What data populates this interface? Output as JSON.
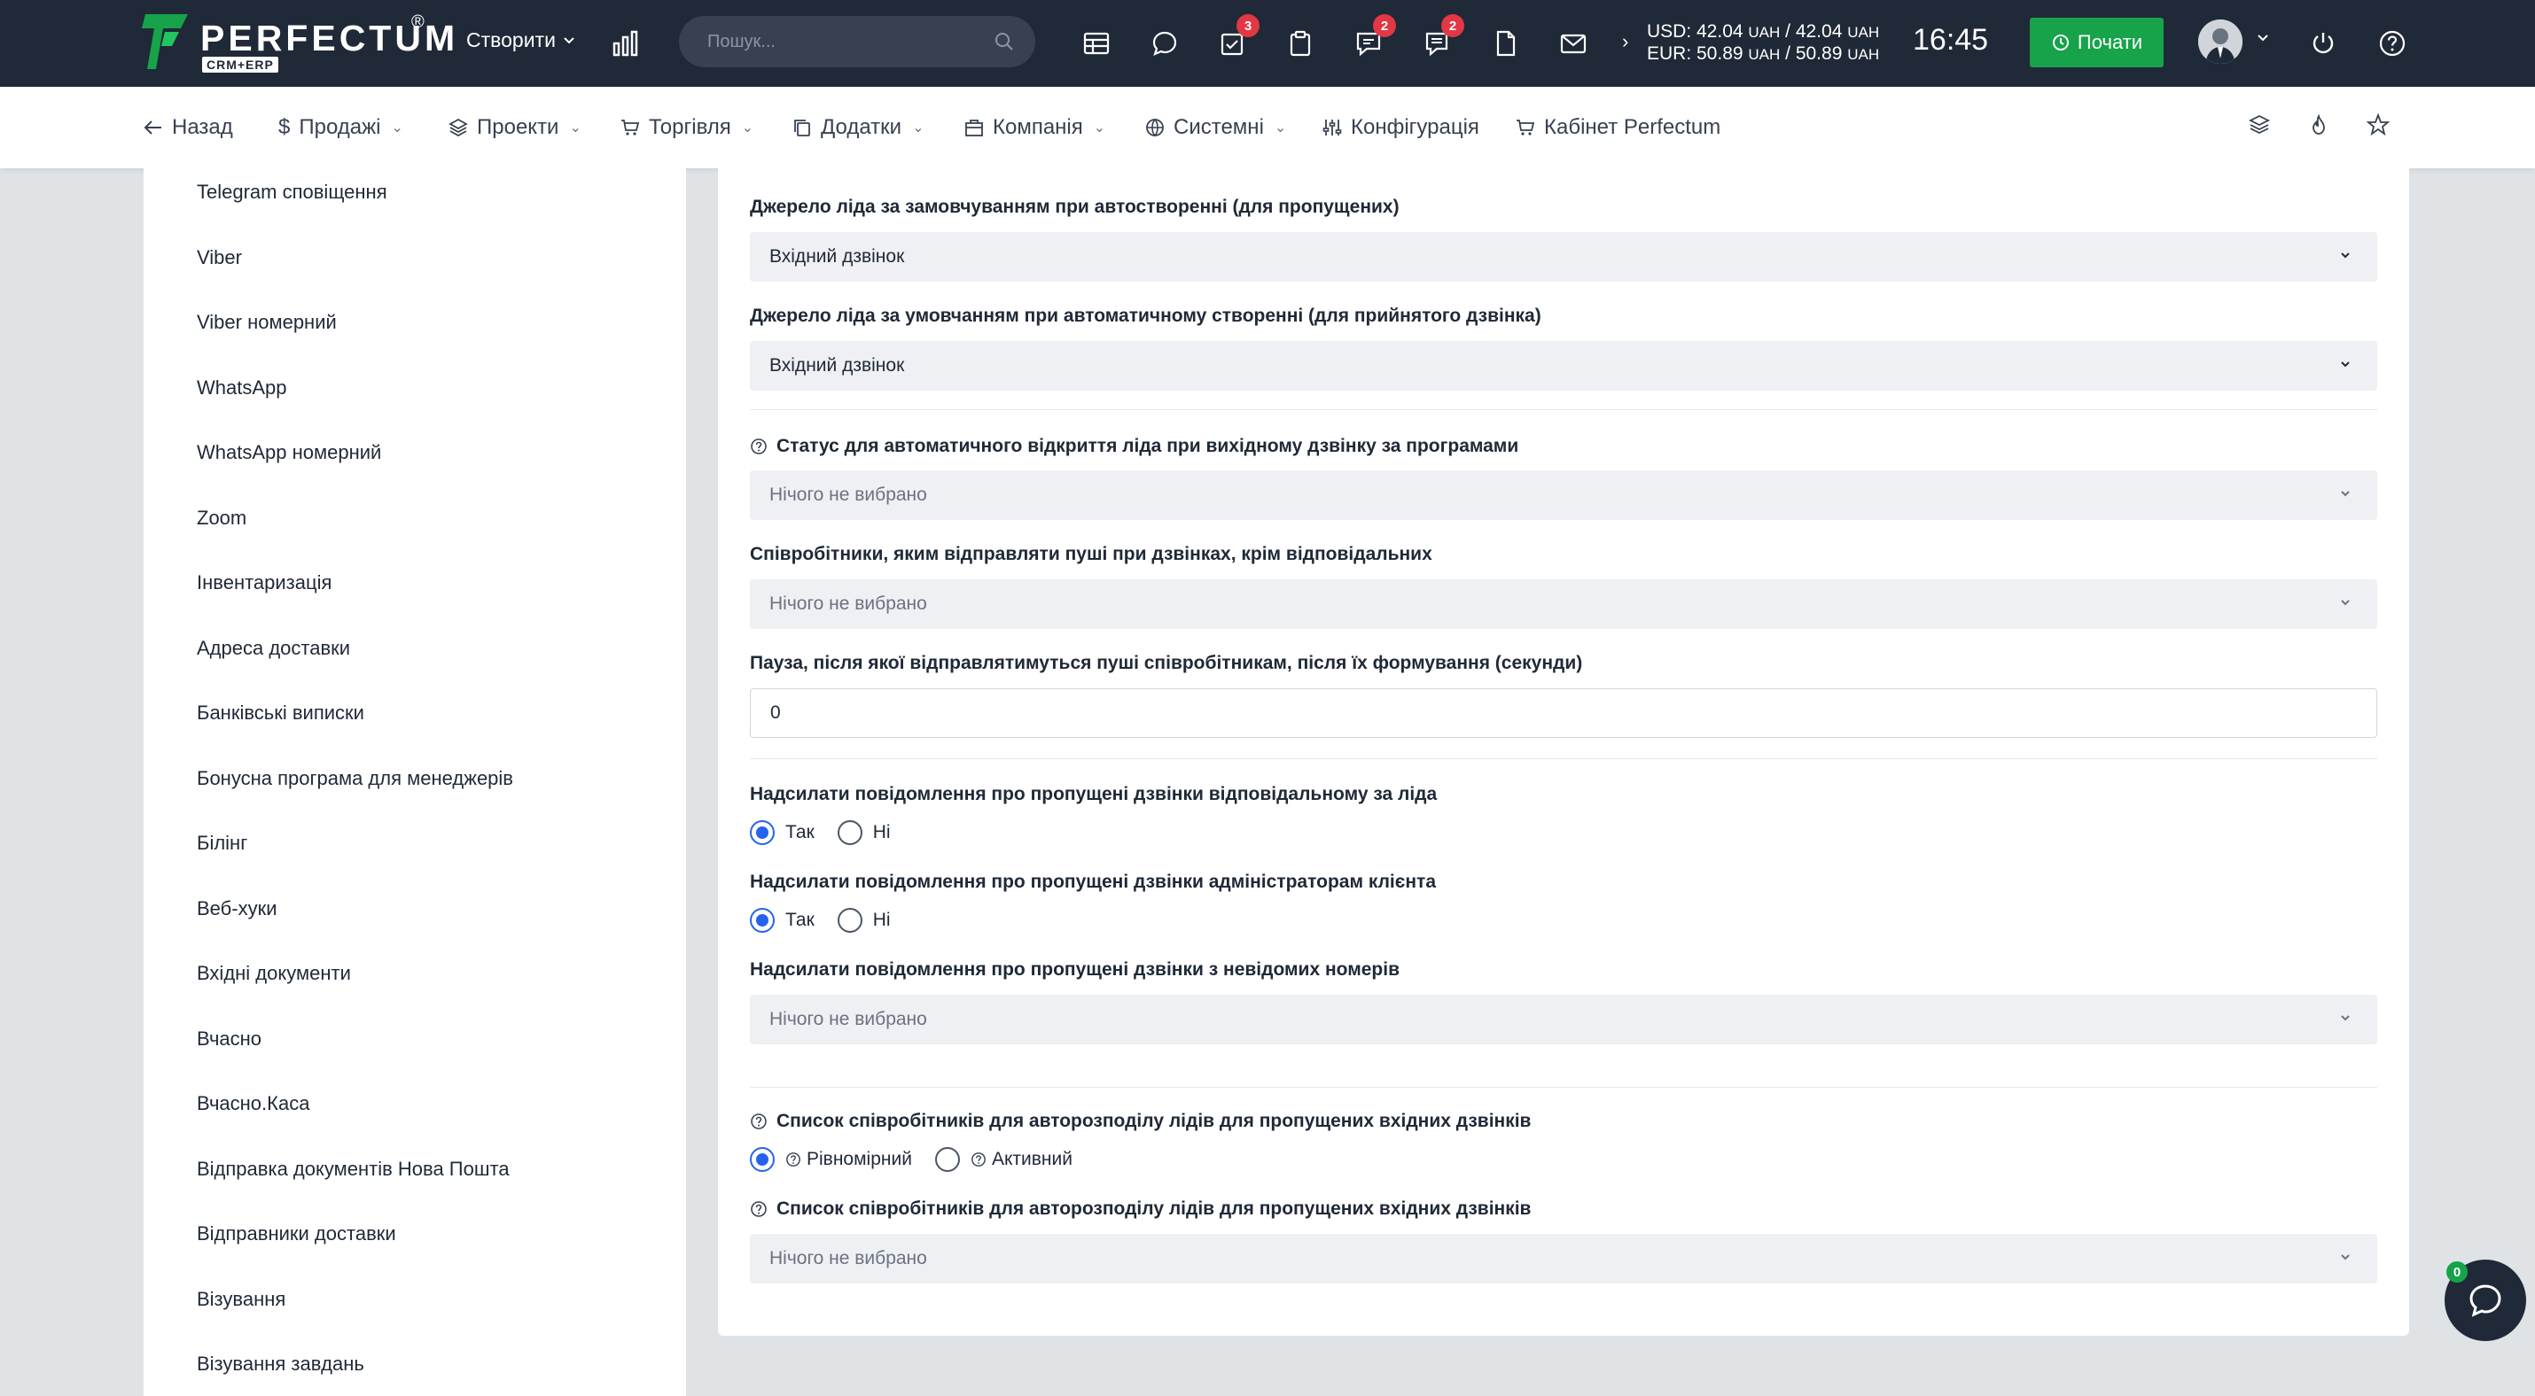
{
  "app": {
    "logo_text": "PERFECTUM",
    "logo_sub": "CRM+ERP",
    "logo_reg": "®",
    "brand_color": "#16a34a"
  },
  "topbar": {
    "create_label": "Створити",
    "search_placeholder": "Пошук...",
    "badges": {
      "tasks": "3",
      "chat": "2",
      "comments": "2"
    },
    "rates_line1": "USD: 42.04",
    "rates_unit1": "UAH",
    "rates_line1b": " / 42.04",
    "rates_unit1b": "UAH",
    "rates_line2": "EUR: 50.89",
    "rates_unit2": "UAH",
    "rates_line2b": " / 50.89",
    "rates_unit2b": "UAH",
    "time": "16:45",
    "start_label": "Почати"
  },
  "subnav": {
    "back": "Назад",
    "sales": "Продажі",
    "projects": "Проекти",
    "trade": "Торгівля",
    "addons": "Додатки",
    "company": "Компанія",
    "system": "Системні",
    "config": "Конфігурація",
    "cabinet": "Кабінет Perfectum"
  },
  "sidebar": {
    "items": [
      "Telegram сповіщення",
      "Viber",
      "Viber номерний",
      "WhatsApp",
      "WhatsApp номерний",
      "Zoom",
      "Інвентаризація",
      "Адреса доставки",
      "Банківські виписки",
      "Бонусна програма для менеджерів",
      "Білінг",
      "Веб-хуки",
      "Вхідні документи",
      "Вчасно",
      "Вчасно.Каса",
      "Відправка документів Нова Пошта",
      "Відправники доставки",
      "Візування",
      "Візування завдань"
    ]
  },
  "form": {
    "f1_label": "Джерело ліда за замовчуванням при автоствореннi (для пропущених)",
    "f1_value": "Вхідний дзвінок",
    "f2_label": "Джерело ліда за умовчанням при автоматичному створенні (для прийнятого дзвінка)",
    "f2_value": "Вхідний дзвінок",
    "f3_label": "Статус для автоматичного відкриття ліда при вихідному дзвінку за програмами",
    "f3_value": "Нічого не вибрано",
    "f4_label": "Співробітники, яким відправляти пуші при дзвінках, крім відповідальних",
    "f4_value": "Нічого не вибрано",
    "f5_label": "Пауза, після якої відправлятимуться пуші співробітникам, після їх формування (секунди)",
    "f5_value": "0",
    "f6_label": "Надсилати повідомлення про пропущені дзвінки відповідальному за ліда",
    "f6_yes": "Так",
    "f6_no": "Ні",
    "f6_selected": "Так",
    "f7_label": "Надсилати повідомлення про пропущені дзвінки адміністраторам клієнта",
    "f7_yes": "Так",
    "f7_no": "Ні",
    "f7_selected": "Так",
    "f8_label": "Надсилати повідомлення про пропущені дзвінки з невідомих номерів",
    "f8_value": "Нічого не вибрано",
    "f9_label": "Список співробітників для авторозподілу лідів для пропущених вхідних дзвінків",
    "f9_opt1": "Рівномірний",
    "f9_opt2": "Активний",
    "f9_selected": "Рівномірний",
    "f10_label": "Список співробітників для авторозподілу лідів для пропущених вхідних дзвінків",
    "f10_value": "Нічого не вибрано"
  },
  "chat": {
    "count": "0"
  }
}
